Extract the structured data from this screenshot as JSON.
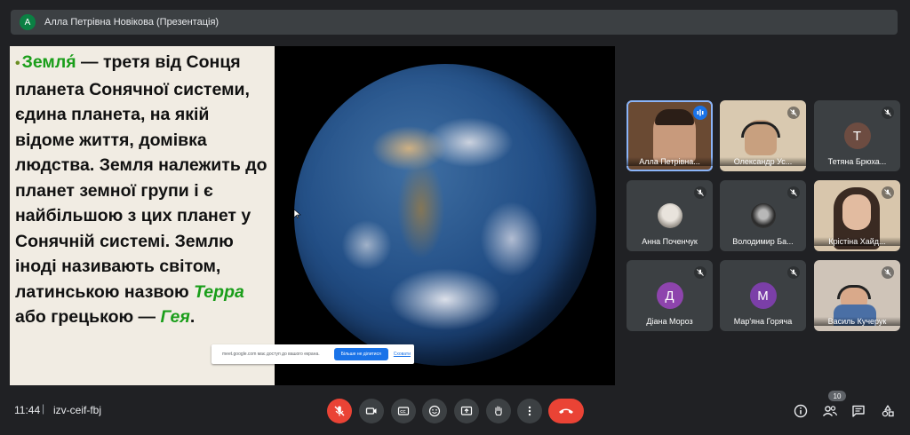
{
  "presenter_bar": {
    "avatar_letter": "А",
    "label": "Алла Петрівна Новікова (Презентація)"
  },
  "slide": {
    "text_parts": [
      {
        "text": "Земля́",
        "style": "green"
      },
      {
        "text": " — третя від Сонця планета Сонячної системи, єдина планета, на якій відоме життя, домівка людства. Земля належить до планет земної групи і є найбільшою з цих планет у Сонячній системі. Землю іноді називають світом, латинською назвою ",
        "style": "plain"
      },
      {
        "text": "Терра",
        "style": "green-it"
      },
      {
        "text": " або грецькою — ",
        "style": "plain"
      },
      {
        "text": "Гея",
        "style": "green-it"
      },
      {
        "text": ".",
        "style": "plain"
      }
    ]
  },
  "share_bar": {
    "text": "meet.google.com має доступ до вашого екрана.",
    "stop_label": "Більше не ділитися",
    "hide_label": "Сховати"
  },
  "participants": [
    {
      "name": "Алла Петрівна...",
      "type": "photo",
      "speaking": true,
      "muted": false
    },
    {
      "name": "Олександр Ус...",
      "type": "photo",
      "muted": true
    },
    {
      "name": "Тетяна Брюха...",
      "type": "letter",
      "letter": "Т",
      "color": "#6d4c41",
      "muted": true
    },
    {
      "name": "Анна Поченчук",
      "type": "photo-small",
      "muted": true
    },
    {
      "name": "Володимир Ба...",
      "type": "photo-small",
      "muted": true
    },
    {
      "name": "Крістіна Хайд...",
      "type": "photo",
      "muted": true
    },
    {
      "name": "Діана Мороз",
      "type": "letter",
      "letter": "Д",
      "color": "#8e44ad",
      "muted": true
    },
    {
      "name": "Мар'яна Горяча",
      "type": "letter",
      "letter": "М",
      "color": "#7b3fa8",
      "muted": true
    },
    {
      "name": "Василь Кучерук",
      "type": "photo",
      "muted": true
    }
  ],
  "bottom_bar": {
    "time": "11:44",
    "separator": "|",
    "meeting_code": "izv-ceif-fbj",
    "participant_count": "10",
    "controls": [
      "mic-off-icon",
      "camera-icon",
      "captions-icon",
      "emoji-icon",
      "present-icon",
      "raise-hand-icon",
      "more-icon",
      "end-call-icon"
    ],
    "side_controls": [
      "info-icon",
      "people-icon",
      "chat-icon",
      "activities-icon"
    ]
  },
  "colors": {
    "background": "#202124",
    "tile": "#3c4043",
    "end_call": "#ea4335",
    "accent": "#1a73e8",
    "slide_green": "#1a9e1a"
  }
}
